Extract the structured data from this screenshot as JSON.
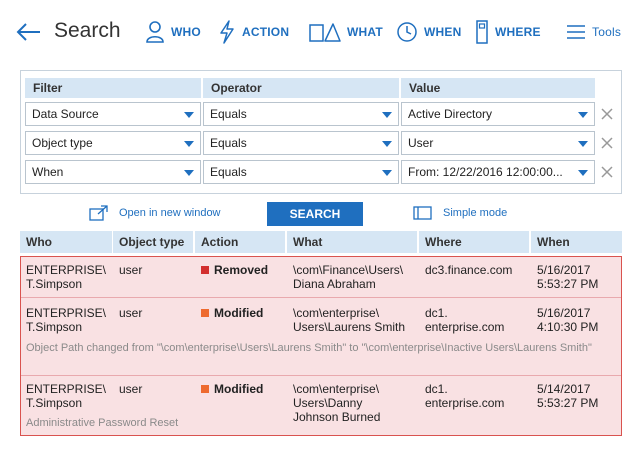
{
  "header": {
    "title": "Search",
    "nav": [
      {
        "label": "WHO",
        "icon": "person-icon"
      },
      {
        "label": "ACTION",
        "icon": "lightning-icon"
      },
      {
        "label": "WHAT",
        "icon": "shapes-icon"
      },
      {
        "label": "WHEN",
        "icon": "clock-icon"
      },
      {
        "label": "WHERE",
        "icon": "building-icon"
      },
      {
        "label": "Tools",
        "icon": "hamburger-icon"
      }
    ]
  },
  "filters": {
    "headers": [
      "Filter",
      "Operator",
      "Value"
    ],
    "rows": [
      {
        "filter": "Data Source",
        "operator": "Equals",
        "value": "Active Directory"
      },
      {
        "filter": "Object type",
        "operator": "Equals",
        "value": "User"
      },
      {
        "filter": "When",
        "operator": "Equals",
        "value": "From: 12/22/2016 12:00:00..."
      }
    ]
  },
  "actions": {
    "open_new_window": "Open in new window",
    "search": "SEARCH",
    "simple_mode": "Simple mode"
  },
  "results": {
    "headers": [
      "Who",
      "Object type",
      "Action",
      "What",
      "Where",
      "When"
    ],
    "colors": {
      "removed": "#d32f2f",
      "modified": "#ee6a2f"
    },
    "rows": [
      {
        "who": [
          "ENTERPRISE\\",
          "T.Simpson"
        ],
        "object_type": "user",
        "action": "Removed",
        "what": [
          "\\com\\Finance\\Users\\",
          "Diana Abraham"
        ],
        "where": [
          "dc3.finance.com"
        ],
        "when": [
          "5/16/2017",
          "5:53:27 PM"
        ],
        "note": ""
      },
      {
        "who": [
          "ENTERPRISE\\",
          "T.Simpson"
        ],
        "object_type": "user",
        "action": "Modified",
        "what": [
          "\\com\\enterprise\\",
          "Users\\Laurens Smith"
        ],
        "where": [
          "dc1.",
          "enterprise.com"
        ],
        "when": [
          "5/16/2017",
          "4:10:30 PM"
        ],
        "note": "Object Path changed from \"\\com\\enterprise\\Users\\Laurens Smith\" to \"\\com\\enterprise\\Inactive Users\\Laurens Smith\""
      },
      {
        "who": [
          "ENTERPRISE\\",
          "T.Simpson"
        ],
        "object_type": "user",
        "action": "Modified",
        "what": [
          "\\com\\enterprise\\",
          "Users\\Danny",
          "Johnson Burned"
        ],
        "where": [
          "dc1.",
          "enterprise.com"
        ],
        "when": [
          "5/14/2017",
          "5:53:27 PM"
        ],
        "note": "Administrative Password Reset"
      }
    ]
  }
}
